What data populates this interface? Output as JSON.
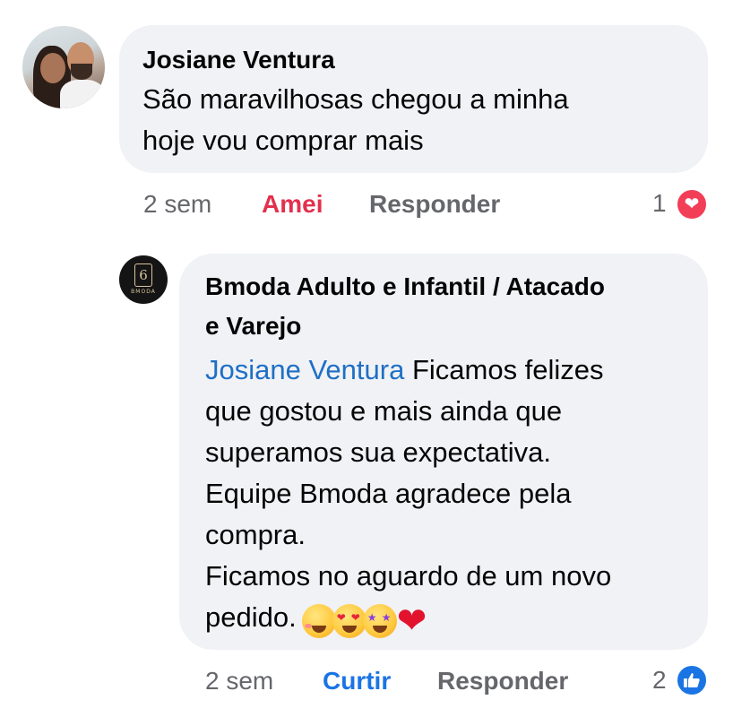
{
  "comments": [
    {
      "author": "Josiane Ventura",
      "text": "São maravilhosas chegou a minha\nhoje vou comprar mais",
      "time": "2 sem",
      "reaction_action": "Amei",
      "reply_action": "Responder",
      "reaction_count": "1",
      "reaction_icon": "heart-icon"
    },
    {
      "author": "Bmoda Adulto e Infantil / Atacado\ne Varejo",
      "avatar_logo_text": "BMODA",
      "mention": "Josiane Ventura",
      "text": " Ficamos felizes\nque gostou e mais ainda que\nsuperamos sua expectativa.\nEquipe Bmoda agradece pela\ncompra.\nFicamos no aguardo de um novo\npedido.",
      "emojis": [
        "smiling-face-with-hearts-emoji",
        "heart-eyes-emoji",
        "star-struck-emoji",
        "red-heart-emoji"
      ],
      "time": "2 sem",
      "reaction_action": "Curtir",
      "reply_action": "Responder",
      "reaction_count": "2",
      "reaction_icon": "like-icon"
    }
  ],
  "colors": {
    "bubble": "#f0f2f5",
    "love": "#e2304d",
    "like": "#1b74e4",
    "mention": "#1f6fc5",
    "meta": "#65676b"
  }
}
